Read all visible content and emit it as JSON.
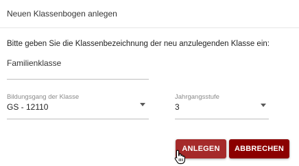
{
  "dialog": {
    "title": "Neuen Klassenbogen anlegen",
    "prompt": "Bitte geben Sie die Klassenbezeichnung der neu anzulegenden Klasse ein:"
  },
  "form": {
    "name_value": "Familienklasse",
    "bildungsgang": {
      "label": "Bildungsgang der Klasse",
      "value": "GS - 12110"
    },
    "jahrgangsstufe": {
      "label": "Jahrgangsstufe",
      "value": "3"
    }
  },
  "buttons": {
    "anlegen": "ANLEGEN",
    "abbrechen": "ABBRECHEN"
  },
  "colors": {
    "anlegen_bg": "#a52a2a",
    "abbrechen_bg": "#8b0000"
  },
  "icons": {
    "dropdown": "chevron-down-icon",
    "cursor": "hand-pointer-icon"
  }
}
